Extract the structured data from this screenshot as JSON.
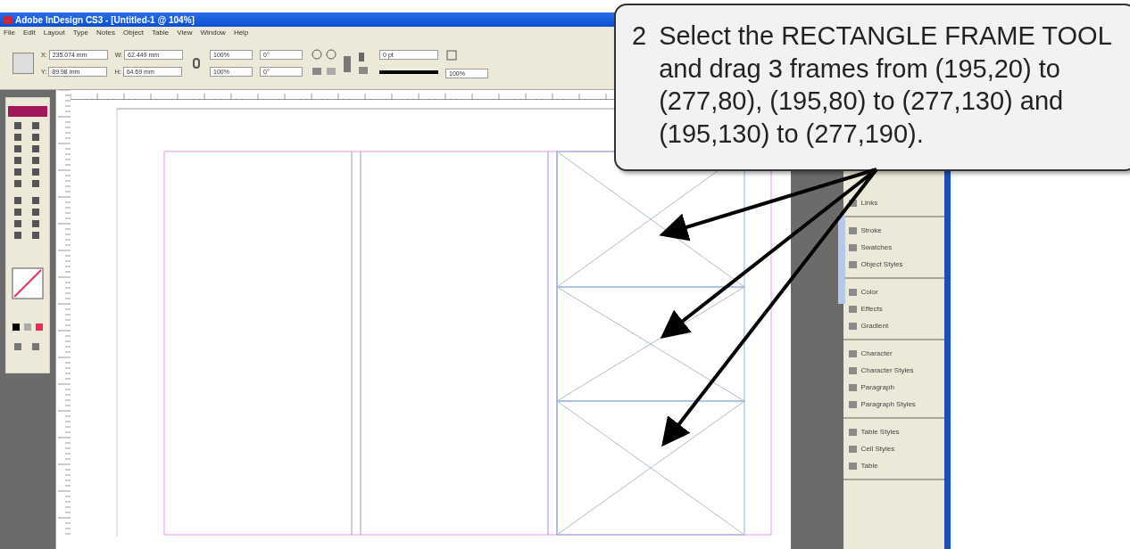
{
  "window": {
    "title": "Adobe InDesign CS3 - [Untitled-1 @ 104%]"
  },
  "menu": [
    "File",
    "Edit",
    "Layout",
    "Type",
    "Notes",
    "Object",
    "Table",
    "View",
    "Window",
    "Help"
  ],
  "control_fields": [
    {
      "label": "X:",
      "value": "235.074 mm"
    },
    {
      "label": "Y:",
      "value": "89.98 mm"
    },
    {
      "label": "W:",
      "value": "62.449 mm"
    },
    {
      "label": "H:",
      "value": "64.69 mm"
    }
  ],
  "scale_fields": [
    "100%",
    "100%"
  ],
  "angle_fields": [
    "0°",
    "0°"
  ],
  "stroke_field": "0 pt",
  "opacity_field": "100%",
  "panel_groups": [
    [
      "Links"
    ],
    [
      "Stroke",
      "Swatches",
      "Object Styles"
    ],
    [
      "Color",
      "Effects",
      "Gradient"
    ],
    [
      "Character",
      "Character Styles",
      "Paragraph",
      "Paragraph Styles"
    ],
    [
      "Table Styles",
      "Cell Styles",
      "Table"
    ]
  ],
  "callout": {
    "number": "2",
    "text": "Select the RECTANGLE FRAME TOOL and drag 3 frames from (195,20) to (277,80), (195,80) to (277,130) and (195,130) to (277,190)."
  }
}
